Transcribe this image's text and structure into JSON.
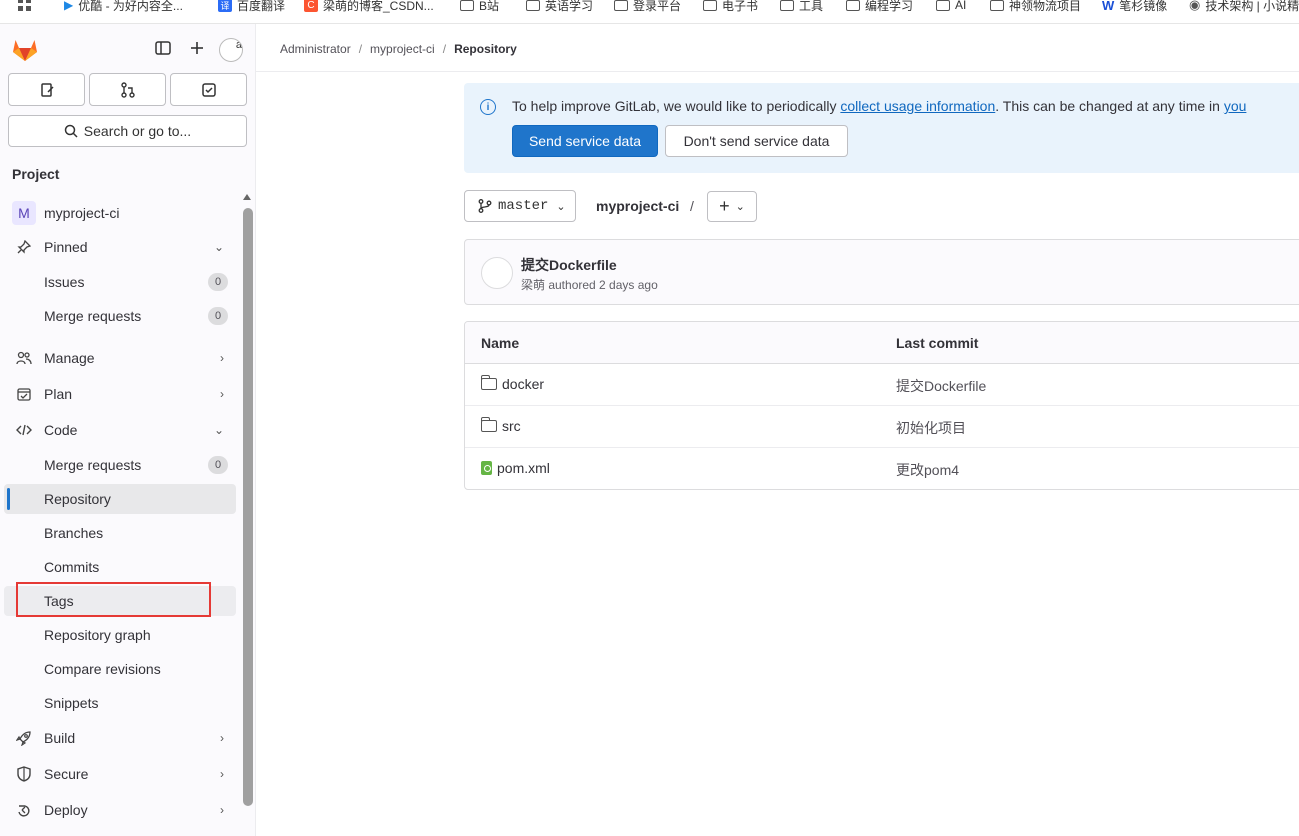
{
  "bookmarks": [
    {
      "label": "优酷 - 为好内容全...",
      "icon": "youku-icon"
    },
    {
      "label": "百度翻译",
      "icon": "baidu-translate-icon"
    },
    {
      "label": "梁萌的博客_CSDN...",
      "icon": "csdn-icon"
    },
    {
      "label": "B站",
      "icon": "folder-icon"
    },
    {
      "label": "英语学习",
      "icon": "folder-icon"
    },
    {
      "label": "登录平台",
      "icon": "folder-icon"
    },
    {
      "label": "电子书",
      "icon": "folder-icon"
    },
    {
      "label": "工具",
      "icon": "folder-icon"
    },
    {
      "label": "编程学习",
      "icon": "folder-icon"
    },
    {
      "label": "AI",
      "icon": "folder-icon"
    },
    {
      "label": "神领物流项目",
      "icon": "folder-icon"
    },
    {
      "label": "笔杉镜像",
      "icon": "bookmark-icon"
    },
    {
      "label": "技术架构 | 小说精",
      "icon": "globe-icon"
    }
  ],
  "sidebar": {
    "avatar_alt": "a",
    "search_label": "Search or go to...",
    "section_title": "Project",
    "project_name": "myproject-ci",
    "project_initial": "M",
    "items": [
      {
        "label": "Pinned",
        "icon": "pin-icon",
        "chevron": "down"
      },
      {
        "label": "Issues",
        "count": "0"
      },
      {
        "label": "Merge requests",
        "count": "0"
      },
      {
        "label": "Manage",
        "icon": "users-icon",
        "chevron": "right"
      },
      {
        "label": "Plan",
        "icon": "calendar-icon",
        "chevron": "right"
      },
      {
        "label": "Code",
        "icon": "code-icon",
        "chevron": "down"
      },
      {
        "label": "Merge requests",
        "count": "0"
      },
      {
        "label": "Repository",
        "active": true
      },
      {
        "label": "Branches"
      },
      {
        "label": "Commits"
      },
      {
        "label": "Tags"
      },
      {
        "label": "Repository graph"
      },
      {
        "label": "Compare revisions"
      },
      {
        "label": "Snippets"
      },
      {
        "label": "Build",
        "icon": "rocket-icon",
        "chevron": "right"
      },
      {
        "label": "Secure",
        "icon": "shield-icon",
        "chevron": "right"
      },
      {
        "label": "Deploy",
        "icon": "deploy-icon",
        "chevron": "right"
      }
    ]
  },
  "breadcrumb": {
    "items": [
      "Administrator",
      "myproject-ci",
      "Repository"
    ]
  },
  "alert": {
    "text_before": "To help improve GitLab, we would like to periodically ",
    "link": "collect usage information",
    "text_after": ". This can be changed at any time in ",
    "link2": "you",
    "primary_button": "Send service data",
    "secondary_button": "Don't send service data"
  },
  "repo": {
    "branch": "master",
    "path": "myproject-ci",
    "path_sep": "/",
    "add_symbol": "+"
  },
  "last_commit": {
    "title": "提交Dockerfile",
    "meta": "梁萌 authored 2 days ago"
  },
  "files": {
    "columns": [
      "Name",
      "Last commit"
    ],
    "rows": [
      {
        "name": "docker",
        "type": "folder",
        "commit": "提交Dockerfile"
      },
      {
        "name": "src",
        "type": "folder",
        "commit": "初始化项目"
      },
      {
        "name": "pom.xml",
        "type": "xml",
        "commit": "更改pom4"
      }
    ]
  },
  "colors": {
    "accent": "#1f75cb",
    "alert_bg": "#e9f3fc",
    "highlight_border": "#e53935"
  }
}
